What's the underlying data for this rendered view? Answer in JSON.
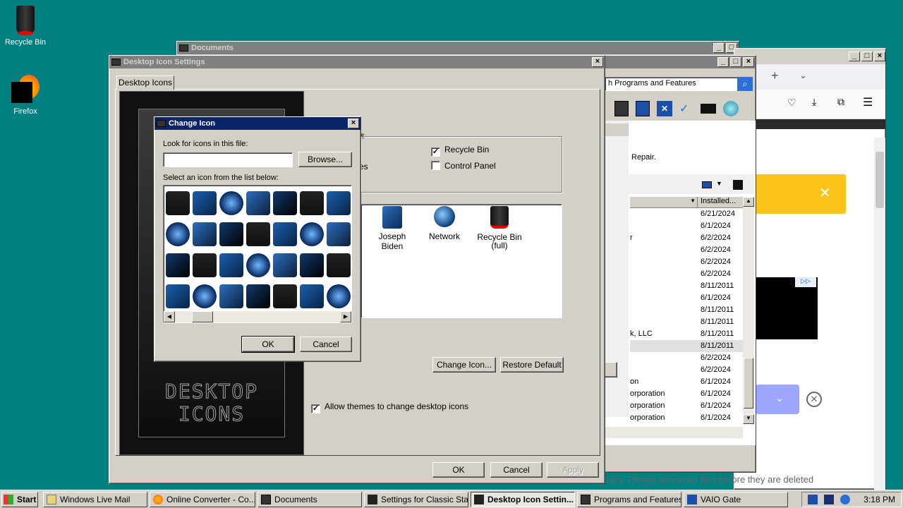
{
  "desktop": {
    "icons": [
      {
        "label": "Recycle Bin"
      },
      {
        "label": "Firefox"
      }
    ]
  },
  "documents_window": {
    "title": "Documents"
  },
  "programs_window": {
    "search_text": "h Programs and Features",
    "repair_text": "Repair.",
    "column_installed": "Installed...",
    "rows": [
      {
        "publisher": "",
        "date": "6/21/2024"
      },
      {
        "publisher": "",
        "date": "6/1/2024"
      },
      {
        "publisher": "r",
        "date": "6/2/2024"
      },
      {
        "publisher": "",
        "date": "6/2/2024"
      },
      {
        "publisher": "",
        "date": "6/2/2024"
      },
      {
        "publisher": "",
        "date": "6/2/2024"
      },
      {
        "publisher": "",
        "date": "8/11/2011"
      },
      {
        "publisher": "",
        "date": "6/1/2024"
      },
      {
        "publisher": "",
        "date": "8/11/2011"
      },
      {
        "publisher": "",
        "date": "8/11/2011"
      },
      {
        "publisher": "k, LLC",
        "date": "8/11/2011"
      },
      {
        "publisher": "",
        "date": "8/11/2011"
      },
      {
        "publisher": "",
        "date": "6/2/2024"
      },
      {
        "publisher": "",
        "date": "6/2/2024"
      },
      {
        "publisher": "on",
        "date": "6/1/2024"
      },
      {
        "publisher": "orporation",
        "date": "6/1/2024"
      },
      {
        "publisher": "orporation",
        "date": "6/1/2024"
      },
      {
        "publisher": "orporation",
        "date": "6/1/2024"
      }
    ]
  },
  "browser_window": {
    "footer_text": "vacy. Please download files before they are deleted"
  },
  "desktop_icon_settings": {
    "title": "Desktop Icon Settings",
    "tab": "Desktop Icons",
    "group_fragment": "s",
    "label_fragment": "es",
    "checkboxes": [
      {
        "label": "Recycle Bin",
        "checked": true
      },
      {
        "label": "Control Panel",
        "checked": false
      }
    ],
    "icons": [
      {
        "label": "Joseph Biden"
      },
      {
        "label": "Network"
      },
      {
        "label": "Recycle Bin\n(full)"
      }
    ],
    "preview_text_line1": "DESKTOP",
    "preview_text_line2": "ICONS",
    "change_icon_button": "Change Icon...",
    "restore_default_button": "Restore Default",
    "allow_themes_label": "Allow themes to change desktop icons",
    "allow_themes_checked": true,
    "ok": "OK",
    "cancel": "Cancel",
    "apply": "Apply"
  },
  "change_icon_dialog": {
    "title": "Change Icon",
    "look_for_label": "Look for icons in this file:",
    "file_value": "",
    "browse": "Browse...",
    "select_label": "Select an icon from the list below:",
    "ok": "OK",
    "cancel": "Cancel"
  },
  "taskbar": {
    "start": "Start",
    "items": [
      {
        "label": "Windows Live Mail"
      },
      {
        "label": "Online Converter - Co..."
      },
      {
        "label": "Documents"
      },
      {
        "label": "Settings for Classic Sta..."
      },
      {
        "label": "Desktop Icon Settin..."
      },
      {
        "label": "Programs and Features"
      },
      {
        "label": "VAIO Gate"
      }
    ],
    "clock": "3:18 PM"
  }
}
